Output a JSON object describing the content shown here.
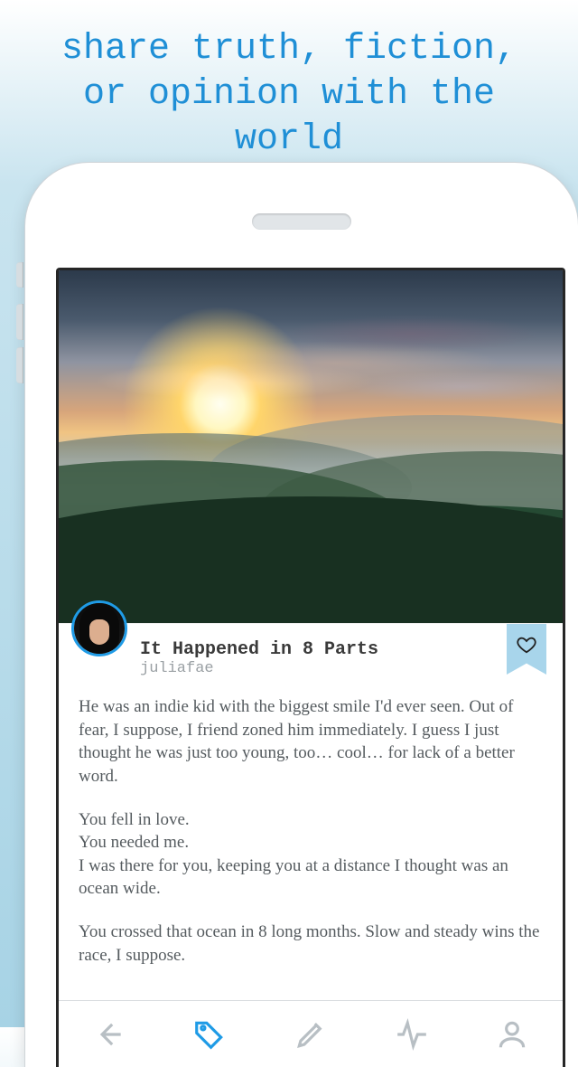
{
  "headline": "share truth, fiction, or opinion with the world",
  "post": {
    "title": "It Happened in 8 Parts",
    "author": "juliafae",
    "paragraphs": [
      "He was an indie kid with the biggest smile I'd ever seen. Out of fear, I suppose, I friend zoned him immediately. I guess I just thought he was just too young, too… cool… for lack of a better word.",
      "You fell in love.\nYou needed me.\nI was there for you, keeping you at a distance I thought was an ocean wide.",
      "You crossed that ocean in 8 long months. Slow and steady wins the race, I suppose."
    ]
  },
  "colors": {
    "accent": "#1f9be6"
  },
  "icons": {
    "heart": "heart-icon",
    "back": "back-icon",
    "tag": "tag-icon",
    "compose": "compose-icon",
    "activity": "activity-icon",
    "profile": "profile-icon"
  },
  "tabs": {
    "activeIndex": 1
  }
}
